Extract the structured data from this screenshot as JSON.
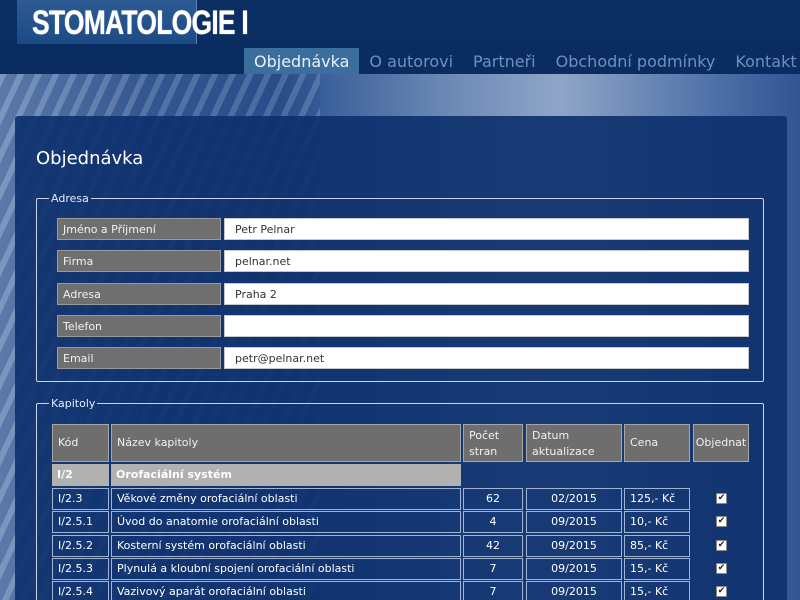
{
  "header": {
    "logo_text": "STOMATOLOGIE I",
    "nav": [
      {
        "label": "Objednávka",
        "active": true
      },
      {
        "label": "O autorovi",
        "active": false
      },
      {
        "label": "Partneři",
        "active": false
      },
      {
        "label": "Obchodní podmínky",
        "active": false
      },
      {
        "label": "Kontakt",
        "active": false
      }
    ]
  },
  "page": {
    "title": "Objednávka"
  },
  "address": {
    "legend": "Adresa",
    "fields": [
      {
        "label": "Jméno a Příjmení",
        "value": "Petr Pelnar"
      },
      {
        "label": "Firma",
        "value": "pelnar.net"
      },
      {
        "label": "Adresa",
        "value": "Praha 2"
      },
      {
        "label": "Telefon",
        "value": ""
      },
      {
        "label": "Email",
        "value": "petr@pelnar.net"
      }
    ]
  },
  "chapters": {
    "legend": "Kapitoly",
    "columns": {
      "code": "Kód",
      "name": "Název kapitoly",
      "pages": "Počet stran",
      "updated": "Datum aktualizace",
      "price": "Cena",
      "order": "Objednat"
    },
    "group": {
      "code": "I/2",
      "name": "Orofaciální systém"
    },
    "rows": [
      {
        "code": "I/2.3",
        "name": "Věkové změny orofaciální oblasti",
        "pages": "62",
        "updated": "02/2015",
        "price": "125,- Kč",
        "checked": true
      },
      {
        "code": "I/2.5.1",
        "name": "Úvod do anatomie orofaciální oblasti",
        "pages": "4",
        "updated": "09/2015",
        "price": "10,- Kč",
        "checked": true
      },
      {
        "code": "I/2.5.2",
        "name": "Kosterní systém orofaciální oblasti",
        "pages": "42",
        "updated": "09/2015",
        "price": "85,- Kč",
        "checked": true
      },
      {
        "code": "I/2.5.3",
        "name": "Plynulá a kloubní spojení orofaciální oblasti",
        "pages": "7",
        "updated": "09/2015",
        "price": "15,- Kč",
        "checked": true
      },
      {
        "code": "I/2.5.4",
        "name": "Vazivový aparát orofaciální oblasti",
        "pages": "7",
        "updated": "09/2015",
        "price": "15,- Kč",
        "checked": true
      }
    ]
  },
  "colors": {
    "background": "#0b2d63",
    "panel": "#0f326e",
    "nav_active": "#3b6e9c",
    "label_bg": "#6f6f6f",
    "group_bg": "#b1b1b1"
  }
}
